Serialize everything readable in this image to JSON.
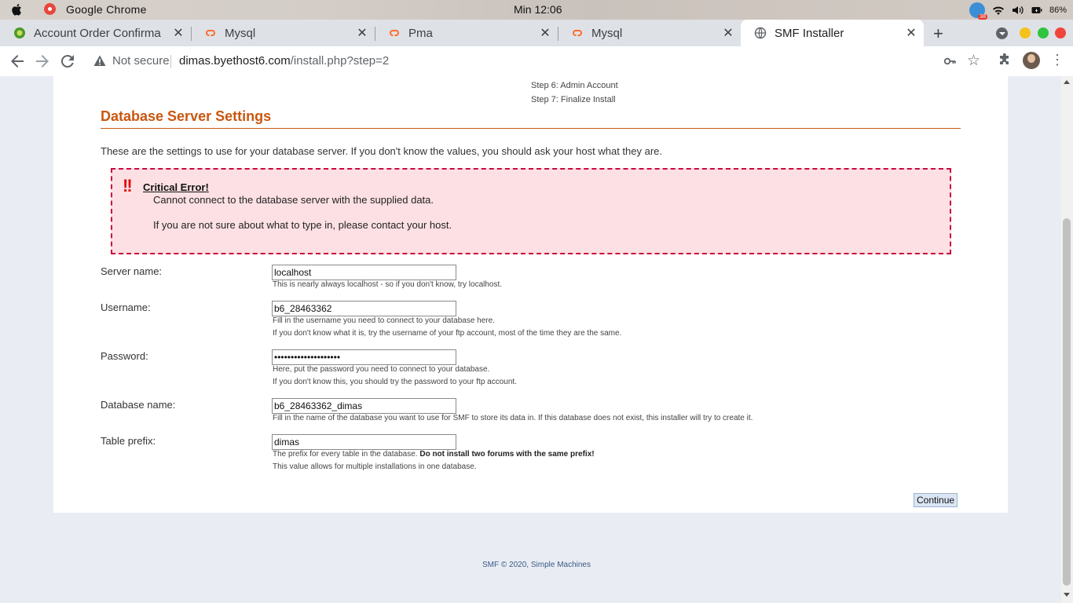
{
  "os": {
    "app_name": "Google Chrome",
    "clock": "Min 12:06",
    "battery": "86%",
    "telegram_badge": "38"
  },
  "tabs": [
    {
      "title": "Account Order Confirma",
      "icon": "hosting-favicon-icon"
    },
    {
      "title": "Mysql",
      "icon": "cpanel-icon"
    },
    {
      "title": "Pma",
      "icon": "cpanel-icon"
    },
    {
      "title": "Mysql",
      "icon": "cpanel-icon"
    },
    {
      "title": "SMF Installer",
      "icon": "globe-icon",
      "active": true
    }
  ],
  "address_bar": {
    "security_label": "Not secure",
    "url_host": "dimas.byethost6.com",
    "url_path": "/install.php?step=2"
  },
  "page": {
    "steps": [
      "Step 6: Admin Account",
      "Step 7: Finalize Install"
    ],
    "heading": "Database Server Settings",
    "intro": "These are the settings to use for your database server. If you don't know the values, you should ask your host what they are.",
    "error": {
      "title": "Critical Error!",
      "message": "Cannot connect to the database server with the supplied data.",
      "help": "If you are not sure about what to type in, please contact your host."
    },
    "fields": {
      "server": {
        "label": "Server name:",
        "value": "localhost",
        "hint1": "This is nearly always localhost - so if you don't know, try localhost."
      },
      "username": {
        "label": "Username:",
        "value": "b6_28463362",
        "hint1": "Fill in the username you need to connect to your database here.",
        "hint2": "If you don't know what it is, try the username of your ftp account, most of the time they are the same."
      },
      "password": {
        "label": "Password:",
        "value": "••••••••••••••••••••",
        "hint1": "Here, put the password you need to connect to your database.",
        "hint2": "If you don't know this, you should try the password to your ftp account."
      },
      "dbname": {
        "label": "Database name:",
        "value": "b6_28463362_dimas",
        "hint1": "Fill in the name of the database you want to use for SMF to store its data in. If this database does not exist, this installer will try to create it."
      },
      "prefix": {
        "label": "Table prefix:",
        "value": "dimas",
        "hint1_plain": "The prefix for every table in the database. ",
        "hint1_bold": "Do not install two forums with the same prefix!",
        "hint2": "This value allows for multiple installations in one database."
      }
    },
    "continue_label": "Continue",
    "footer_prefix": "SMF © 2020, ",
    "footer_link": "Simple Machines"
  },
  "colors": {
    "heading": "#c9570f",
    "error_border": "#c80a3c",
    "error_bg": "#fde0e4",
    "page_bg": "#e9edf3"
  }
}
